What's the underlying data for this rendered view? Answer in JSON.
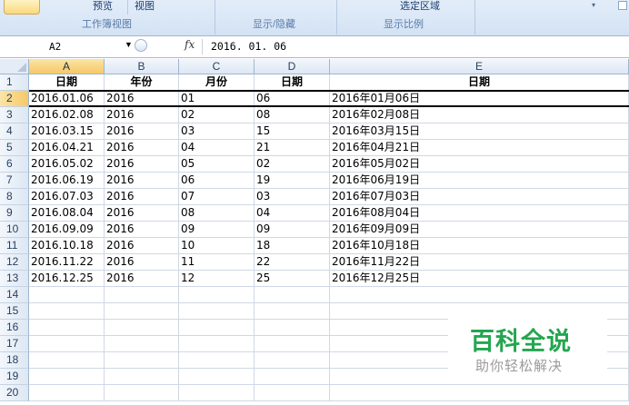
{
  "ribbon": {
    "labels": [
      "预览",
      "视图",
      "选定区域"
    ],
    "groups": [
      "工作簿视图",
      "显示/隐藏",
      "显示比例"
    ]
  },
  "formula_bar": {
    "name_box": "A2",
    "fx_label": "fx",
    "value": "2016. 01. 06"
  },
  "sheet": {
    "columns": [
      "A",
      "B",
      "C",
      "D",
      "E"
    ],
    "rows": [
      "1",
      "2",
      "3",
      "4",
      "5",
      "6",
      "7",
      "8",
      "9",
      "10",
      "11",
      "12",
      "13",
      "14",
      "15",
      "16",
      "17",
      "18",
      "19",
      "20"
    ],
    "header_row": [
      "日期",
      "年份",
      "月份",
      "日期",
      "日期"
    ],
    "data": [
      [
        "2016.01.06",
        "2016",
        "01",
        "06",
        "2016年01月06日"
      ],
      [
        "2016.02.08",
        "2016",
        "02",
        "08",
        "2016年02月08日"
      ],
      [
        "2016.03.15",
        "2016",
        "03",
        "15",
        "2016年03月15日"
      ],
      [
        "2016.04.21",
        "2016",
        "04",
        "21",
        "2016年04月21日"
      ],
      [
        "2016.05.02",
        "2016",
        "05",
        "02",
        "2016年05月02日"
      ],
      [
        "2016.06.19",
        "2016",
        "06",
        "19",
        "2016年06月19日"
      ],
      [
        "2016.07.03",
        "2016",
        "07",
        "03",
        "2016年07月03日"
      ],
      [
        "2016.08.04",
        "2016",
        "08",
        "04",
        "2016年08月04日"
      ],
      [
        "2016.09.09",
        "2016",
        "09",
        "09",
        "2016年09月09日"
      ],
      [
        "2016.10.18",
        "2016",
        "10",
        "18",
        "2016年10月18日"
      ],
      [
        "2016.11.22",
        "2016",
        "11",
        "22",
        "2016年11月22日"
      ],
      [
        "2016.12.25",
        "2016",
        "12",
        "25",
        "2016年12月25日"
      ]
    ],
    "active_cell": "A2",
    "active_row": "2",
    "active_column": "A"
  },
  "watermark": {
    "title": "百科全说",
    "subtitle": "助你轻松解决"
  },
  "colors": {
    "accent_green": "#23a64f",
    "active_header": "#f6c867"
  }
}
